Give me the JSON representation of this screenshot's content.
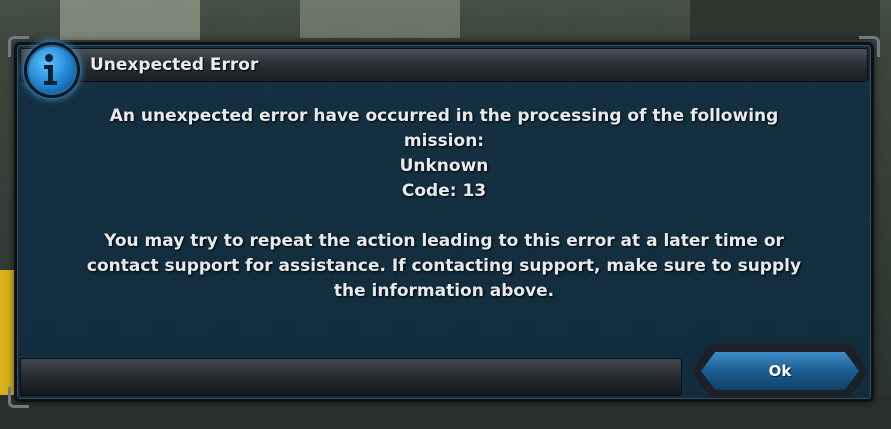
{
  "dialog": {
    "title": "Unexpected Error",
    "icon": "info-icon",
    "message_lines": [
      "An unexpected error have occurred in the processing of the following",
      "mission:",
      "Unknown",
      "Code: 13"
    ],
    "advice_lines": [
      "You may try to repeat the action leading to this error at a later time or",
      "contact support for assistance. If contacting support, make sure to supply",
      "the information above."
    ],
    "ok_label": "Ok"
  },
  "colors": {
    "panel": "#0c2c42",
    "button": "#1b5d90",
    "accent": "#4fb8ff"
  }
}
